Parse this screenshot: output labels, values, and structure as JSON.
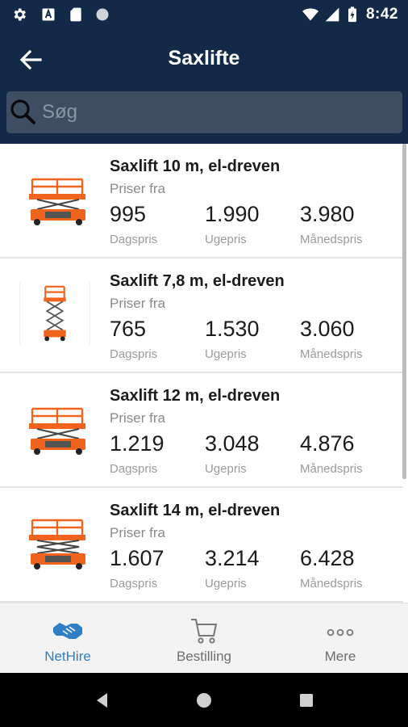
{
  "status_bar": {
    "time": "8:42"
  },
  "app_bar": {
    "title": "Saxlifte"
  },
  "search": {
    "placeholder": "Søg",
    "value": ""
  },
  "products": [
    {
      "name": "Saxlift 10 m, el-dreven",
      "from_label": "Priser fra",
      "day_price": "995",
      "week_price": "1.990",
      "month_price": "3.980",
      "day_label": "Dagspris",
      "week_label": "Ugepris",
      "month_label": "Månedspris"
    },
    {
      "name": "Saxlift 7,8 m, el-dreven",
      "from_label": "Priser fra",
      "day_price": "765",
      "week_price": "1.530",
      "month_price": "3.060",
      "day_label": "Dagspris",
      "week_label": "Ugepris",
      "month_label": "Månedspris"
    },
    {
      "name": "Saxlift 12 m, el-dreven",
      "from_label": "Priser fra",
      "day_price": "1.219",
      "week_price": "3.048",
      "month_price": "4.876",
      "day_label": "Dagspris",
      "week_label": "Ugepris",
      "month_label": "Månedspris"
    },
    {
      "name": "Saxlift 14 m, el-dreven",
      "from_label": "Priser fra",
      "day_price": "1.607",
      "week_price": "3.214",
      "month_price": "6.428",
      "day_label": "Dagspris",
      "week_label": "Ugepris",
      "month_label": "Månedspris"
    }
  ],
  "tabs": [
    {
      "label": "NetHire",
      "icon": "handshake-icon",
      "active": true
    },
    {
      "label": "Bestilling",
      "icon": "cart-icon",
      "active": false
    },
    {
      "label": "Mere",
      "icon": "more-dots-icon",
      "active": false
    }
  ],
  "colors": {
    "header": "#122a47",
    "accent": "#2e7fc6",
    "lift_orange": "#f0641e"
  }
}
